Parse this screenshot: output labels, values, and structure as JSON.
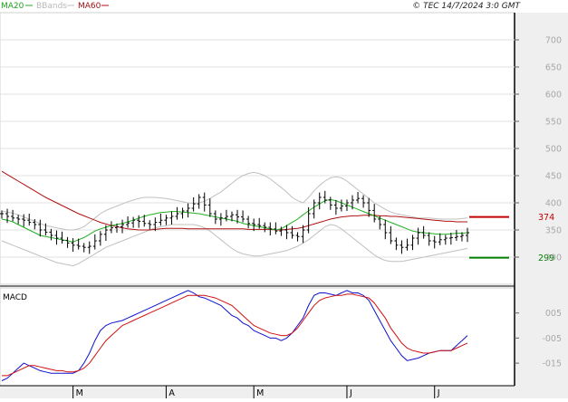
{
  "legend": {
    "ma20_label": "MA20",
    "bbands_label": "BBands",
    "ma60_label": "MA60",
    "colors": {
      "ma20": "#20b020",
      "bbands": "#c0c0c0",
      "ma60": "#b01010"
    }
  },
  "copyright": "© TEC 14/7/2024 3:0 GMT",
  "macd_title": "MACD",
  "chart_data": [
    {
      "type": "line",
      "subtype": "ohlc-price",
      "ylim": [
        250,
        750
      ],
      "y_ticks": [
        300,
        350,
        400,
        450,
        500,
        550,
        600,
        650,
        700
      ],
      "grid": true,
      "x_ticks": [
        "M",
        "A",
        "M",
        "J",
        "J"
      ],
      "levels": [
        {
          "label": "374",
          "value": 374,
          "color": "#c00000"
        },
        {
          "label": "299",
          "value": 299,
          "color": "#008000"
        }
      ],
      "price_path": [
        380,
        375,
        372,
        370,
        368,
        364,
        360,
        350,
        346,
        340,
        335,
        331,
        326,
        322,
        320,
        318,
        320,
        330,
        342,
        350,
        354,
        356,
        360,
        363,
        368,
        366,
        362,
        360,
        364,
        368,
        372,
        375,
        380,
        385,
        390,
        398,
        410,
        396,
        380,
        370,
        372,
        375,
        378,
        374,
        370,
        362,
        360,
        358,
        355,
        352,
        348,
        350,
        345,
        340,
        338,
        350,
        380,
        400,
        410,
        405,
        396,
        390,
        394,
        400,
        405,
        408,
        400,
        386,
        370,
        360,
        345,
        330,
        322,
        318,
        322,
        335,
        345,
        340,
        330,
        328,
        332,
        335,
        336,
        338,
        340,
        345
      ],
      "series": [
        {
          "name": "MA20",
          "values": [
            370,
            368,
            365,
            360,
            355,
            350,
            345,
            340,
            338,
            336,
            334,
            332,
            330,
            328,
            332,
            336,
            342,
            348,
            352,
            355,
            358,
            360,
            362,
            365,
            368,
            372,
            375,
            378,
            380,
            382,
            383,
            384,
            384,
            383,
            382,
            381,
            380,
            378,
            376,
            374,
            372,
            370,
            368,
            366,
            362,
            360,
            358,
            356,
            354,
            352,
            350,
            352,
            358,
            364,
            370,
            378,
            385,
            392,
            398,
            404,
            406,
            404,
            400,
            396,
            392,
            388,
            384,
            380,
            376,
            372,
            368,
            364,
            360,
            356,
            352,
            348,
            346,
            345,
            344,
            343,
            342,
            342,
            343,
            344,
            344,
            345
          ]
        },
        {
          "name": "MA60",
          "values": [
            458,
            452,
            446,
            440,
            434,
            428,
            422,
            416,
            410,
            405,
            400,
            395,
            390,
            385,
            380,
            376,
            372,
            368,
            364,
            361,
            358,
            356,
            354,
            352,
            351,
            350,
            350,
            350,
            351,
            352,
            353,
            353,
            353,
            353,
            352,
            352,
            352,
            352,
            352,
            352,
            352,
            352,
            352,
            352,
            352,
            351,
            351,
            351,
            351,
            351,
            350,
            350,
            351,
            352,
            353,
            355,
            358,
            361,
            364,
            367,
            370,
            372,
            374,
            375,
            376,
            376,
            377,
            377,
            377,
            376,
            376,
            375,
            375,
            374,
            373,
            372,
            371,
            370,
            369,
            368,
            367,
            366,
            366,
            365,
            365,
            365
          ]
        },
        {
          "name": "BBands",
          "values_upper": [
            385,
            383,
            381,
            378,
            374,
            370,
            366,
            362,
            358,
            356,
            354,
            352,
            350,
            350,
            352,
            356,
            364,
            372,
            380,
            386,
            390,
            394,
            398,
            402,
            405,
            408,
            410,
            410,
            410,
            409,
            408,
            406,
            404,
            402,
            400,
            399,
            400,
            403,
            408,
            414,
            420,
            428,
            436,
            444,
            450,
            454,
            456,
            454,
            450,
            444,
            436,
            428,
            420,
            410,
            404,
            400,
            410,
            422,
            432,
            440,
            446,
            448,
            446,
            440,
            432,
            424,
            416,
            408,
            400,
            394,
            388,
            383,
            380,
            378,
            376,
            374,
            372,
            372,
            372,
            371,
            370,
            370,
            370,
            370,
            371,
            372
          ],
          "values_lower": [
            330,
            326,
            322,
            318,
            314,
            310,
            306,
            302,
            298,
            294,
            290,
            288,
            286,
            284,
            288,
            294,
            300,
            306,
            312,
            318,
            322,
            326,
            330,
            334,
            338,
            342,
            346,
            350,
            354,
            356,
            358,
            360,
            360,
            360,
            360,
            360,
            358,
            354,
            348,
            340,
            332,
            324,
            316,
            310,
            306,
            304,
            302,
            302,
            304,
            306,
            308,
            310,
            312,
            316,
            320,
            326,
            332,
            340,
            348,
            356,
            360,
            358,
            352,
            344,
            336,
            328,
            320,
            312,
            304,
            298,
            294,
            292,
            292,
            292,
            294,
            296,
            298,
            300,
            302,
            304,
            306,
            308,
            310,
            312,
            314,
            316
          ]
        }
      ]
    },
    {
      "type": "line",
      "subtype": "macd",
      "title": "MACD",
      "ylim": [
        -0.24,
        0.15
      ],
      "y_ticks": [
        0.05,
        -0.05,
        -0.15
      ],
      "y_tick_labels": [
        "005",
        "-005",
        "-015"
      ],
      "series": [
        {
          "name": "MACD",
          "values": [
            -0.22,
            -0.21,
            -0.19,
            -0.17,
            -0.15,
            -0.16,
            -0.17,
            -0.18,
            -0.185,
            -0.19,
            -0.19,
            -0.19,
            -0.19,
            -0.19,
            -0.18,
            -0.15,
            -0.11,
            -0.06,
            -0.02,
            0.0,
            0.01,
            0.015,
            0.02,
            0.03,
            0.04,
            0.05,
            0.06,
            0.07,
            0.08,
            0.09,
            0.1,
            0.11,
            0.12,
            0.13,
            0.14,
            0.13,
            0.115,
            0.11,
            0.1,
            0.09,
            0.08,
            0.06,
            0.04,
            0.03,
            0.01,
            0.0,
            -0.02,
            -0.03,
            -0.04,
            -0.05,
            -0.05,
            -0.06,
            -0.05,
            -0.03,
            0.0,
            0.03,
            0.08,
            0.12,
            0.13,
            0.13,
            0.125,
            0.12,
            0.13,
            0.14,
            0.13,
            0.13,
            0.12,
            0.1,
            0.06,
            0.02,
            -0.02,
            -0.06,
            -0.09,
            -0.12,
            -0.14,
            -0.135,
            -0.13,
            -0.12,
            -0.11,
            -0.105,
            -0.1,
            -0.1,
            -0.1,
            -0.08,
            -0.06,
            -0.04
          ]
        },
        {
          "name": "Signal",
          "values": [
            -0.2,
            -0.2,
            -0.19,
            -0.18,
            -0.17,
            -0.16,
            -0.16,
            -0.165,
            -0.17,
            -0.175,
            -0.18,
            -0.18,
            -0.185,
            -0.185,
            -0.18,
            -0.17,
            -0.15,
            -0.12,
            -0.09,
            -0.06,
            -0.04,
            -0.02,
            0.0,
            0.01,
            0.02,
            0.03,
            0.04,
            0.05,
            0.06,
            0.07,
            0.08,
            0.09,
            0.1,
            0.11,
            0.12,
            0.12,
            0.12,
            0.12,
            0.115,
            0.11,
            0.1,
            0.09,
            0.08,
            0.06,
            0.04,
            0.02,
            0.0,
            -0.01,
            -0.02,
            -0.03,
            -0.035,
            -0.04,
            -0.04,
            -0.03,
            -0.01,
            0.02,
            0.05,
            0.08,
            0.1,
            0.11,
            0.115,
            0.12,
            0.12,
            0.125,
            0.125,
            0.12,
            0.115,
            0.11,
            0.09,
            0.06,
            0.03,
            -0.01,
            -0.04,
            -0.07,
            -0.09,
            -0.1,
            -0.105,
            -0.11,
            -0.11,
            -0.105,
            -0.1,
            -0.1,
            -0.1,
            -0.09,
            -0.08,
            -0.07
          ]
        }
      ]
    }
  ]
}
